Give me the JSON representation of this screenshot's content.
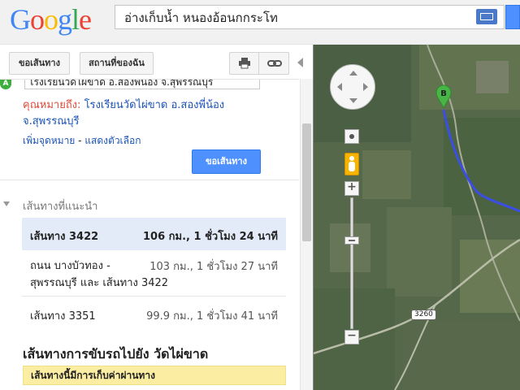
{
  "header": {
    "logo_letters": [
      {
        "char": "G",
        "color": "#4285f4"
      },
      {
        "char": "o",
        "color": "#ea4335"
      },
      {
        "char": "o",
        "color": "#fbbc05"
      },
      {
        "char": "g",
        "color": "#4285f4"
      },
      {
        "char": "l",
        "color": "#34a853"
      },
      {
        "char": "e",
        "color": "#ea4335"
      }
    ],
    "search_value": "อ่างเก็บน้ำ หนองอ้อนกกระโท",
    "keyboard_icon": "keyboard-icon"
  },
  "toolbar": {
    "directions_label": "ขอเส้นทาง",
    "nearby_label": "สถานที่ของฉัน",
    "print_icon": "print-icon",
    "link_icon": "link-icon"
  },
  "form": {
    "origin_marker": "A",
    "origin_value": "โรงเรียนวัดไผ่ขาด อ.สองพี่น้อง จ.สุพรรณบุรี",
    "destination_label": "คุณหมายถึง:",
    "destination_line1": "โรงเรียนวัดไผ่ขาด อ.สองพี่น้อง",
    "destination_line2": "จ.สุพรรณบุรี",
    "add_destination": "เพิ่มจุดหมาย",
    "separator": " - ",
    "show_options": "แสดงตัวเลือก",
    "get_directions_label": "ขอเส้นทาง"
  },
  "suggested": {
    "heading": "เส้นทางที่แนะนำ",
    "routes": [
      {
        "name": "เส้นทาง 3422",
        "info": "106 กม., 1 ชั่วโมง 24 นาที"
      },
      {
        "name_line1": "ถนน บางบัวทอง -",
        "name_line2": "สุพรรณบุรี และ เส้นทาง 3422",
        "info": "103 กม., 1 ชั่วโมง 27 นาที"
      },
      {
        "name": "เส้นทาง 3351",
        "info": "99.9 กม., 1 ชั่วโมง 41 นาที"
      }
    ]
  },
  "driving": {
    "heading": "เส้นทางการขับรถไปยัง วัดไผ่ขาด",
    "toll_notice": "เส้นทางนี้มีการเก็บค่าผ่านทาง"
  },
  "map": {
    "marker_b": "B",
    "road_label": "3260",
    "route_color": "#3b4ee6",
    "zoom_level_fraction": 0.3
  }
}
